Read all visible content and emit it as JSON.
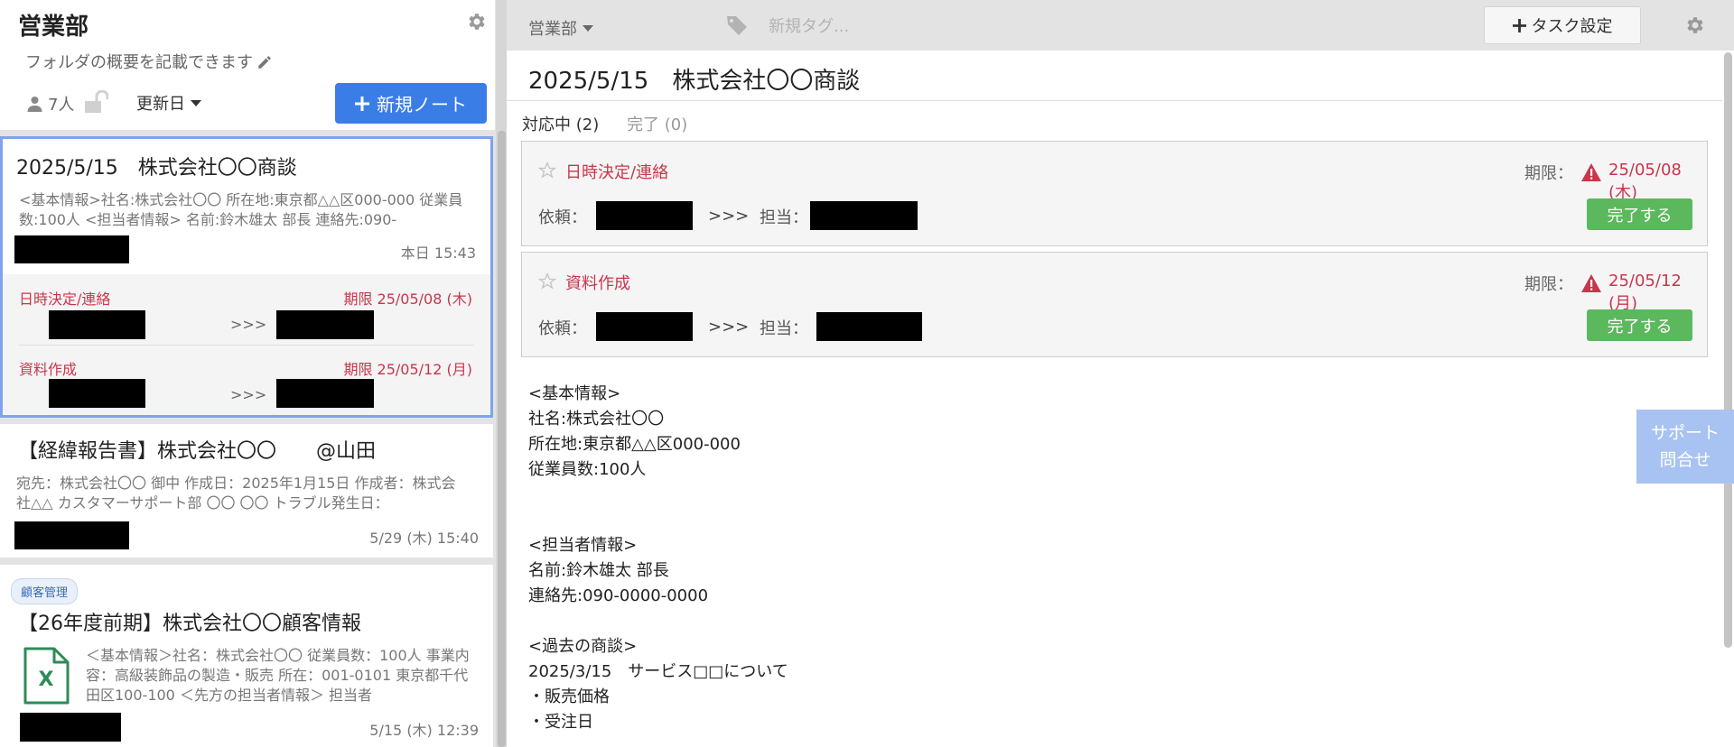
{
  "folder": {
    "title": "営業部",
    "description": "フォルダの概要を記載できます",
    "member_count": "7人",
    "sort_label": "更新日",
    "new_note_label": "新規ノート"
  },
  "notes": [
    {
      "title": "2025/5/15　株式会社〇〇商談",
      "summary": "<基本情報>社名:株式会社〇〇 所在地:東京都△△区000-000 従業員数:100人 <担当者情報> 名前:鈴木雄太 部長 連絡先:090-",
      "date": "本日 15:43",
      "tasks": [
        {
          "title": "日時決定/連絡",
          "due": "期限 25/05/08 (木)",
          "arrow": ">>>"
        },
        {
          "title": "資料作成",
          "due": "期限 25/05/12 (月)",
          "arrow": ">>>"
        }
      ]
    },
    {
      "title": "【経緯報告書】株式会社〇〇　　@山田",
      "summary": "宛先：株式会社〇〇 御中 作成日：2025年1月15日 作成者：株式会社△△ カスタマーサポート部 〇〇 〇〇 トラブル発生日：",
      "date": "5/29 (木) 15:40"
    },
    {
      "tag": "顧客管理",
      "title": "【26年度前期】株式会社〇〇顧客情報",
      "summary": "＜基本情報＞社名：株式会社〇〇 従業員数：100人 事業内容：高級装飾品の製造・販売 所在：001-0101 東京都千代田区100-100 ＜先方の担当者情報＞ 担当者",
      "date": "5/15 (木) 12:39",
      "attachment_icon": "excel-file-icon",
      "attachment_letter": "X"
    }
  ],
  "topbar": {
    "folder_label": "営業部",
    "tag_placeholder": "新規タグ...",
    "task_settings_label": "タスク設定"
  },
  "detail": {
    "title": "2025/5/15　株式会社〇〇商談",
    "tab_active": "対応中 (2)",
    "tab_done": "完了 (0)",
    "tasks": [
      {
        "title": "日時決定/連絡",
        "due_label": "期限：",
        "due_value": "25/05/08 (木)",
        "request_label": "依頼：",
        "arrows": ">>>",
        "assignee_label": "担当：",
        "complete_label": "完了する"
      },
      {
        "title": "資料作成",
        "due_label": "期限：",
        "due_value": "25/05/12 (月)",
        "request_label": "依頼：",
        "arrows": ">>>",
        "assignee_label": "担当：",
        "complete_label": "完了する"
      }
    ],
    "body": "<基本情報>\n社名:株式会社〇〇\n所在地:東京都△△区000-000\n従業員数:100人\n\n\n<担当者情報>\n名前:鈴木雄太 部長\n連絡先:090-0000-0000\n\n<過去の商談>\n2025/3/15　サービス□□について\n・販売価格\n・受注日"
  },
  "support": {
    "line1": "サポート",
    "line2": "問合せ"
  },
  "colors": {
    "accent": "#3b7de6",
    "task_red": "#c8364c",
    "complete_green": "#5cb85c",
    "selected_border": "#7fa3ee",
    "support_bg": "#a8c3f2"
  }
}
